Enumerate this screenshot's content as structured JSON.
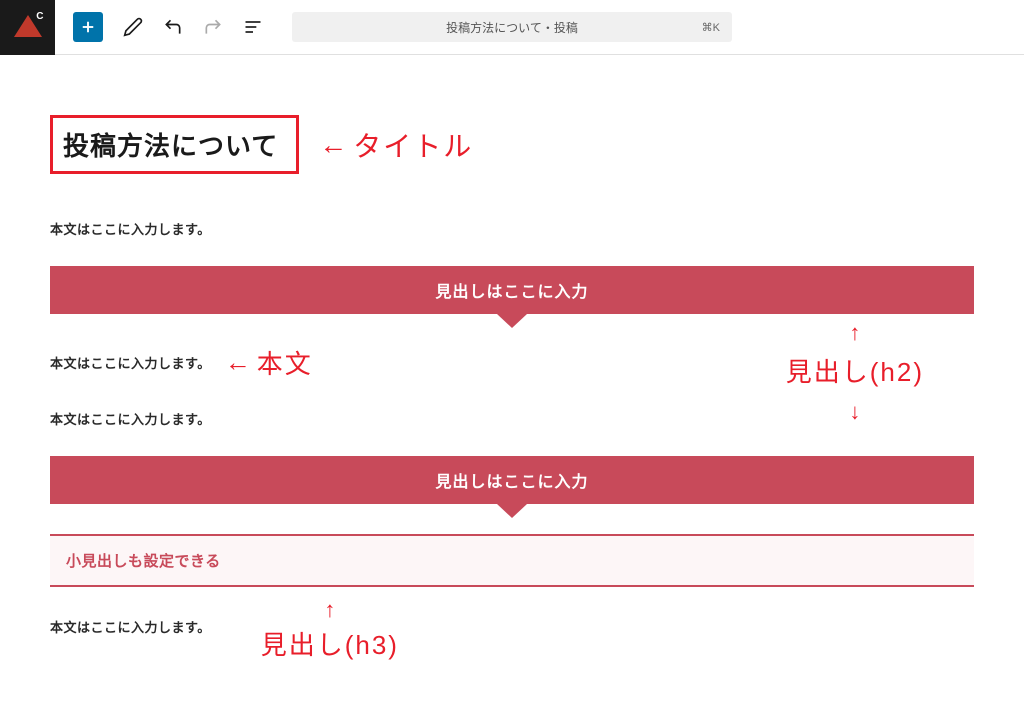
{
  "toolbar": {
    "document_title": "投稿方法について・投稿",
    "shortcut": "⌘K"
  },
  "content": {
    "title": "投稿方法について",
    "body1": "本文はここに入力します。",
    "h2_1": "見出しはここに入力",
    "body2": "本文はここに入力します。",
    "body3": "本文はここに入力します。",
    "h2_2": "見出しはここに入力",
    "h3": "小見出しも設定できる",
    "body4": "本文はここに入力します。"
  },
  "annotations": {
    "title_label": "タイトル",
    "body_label": "本文",
    "h2_label": "見出し(h2)",
    "h3_label": "見出し(h3)",
    "arrow_left": "←",
    "arrow_up": "↑",
    "arrow_down": "↓"
  }
}
